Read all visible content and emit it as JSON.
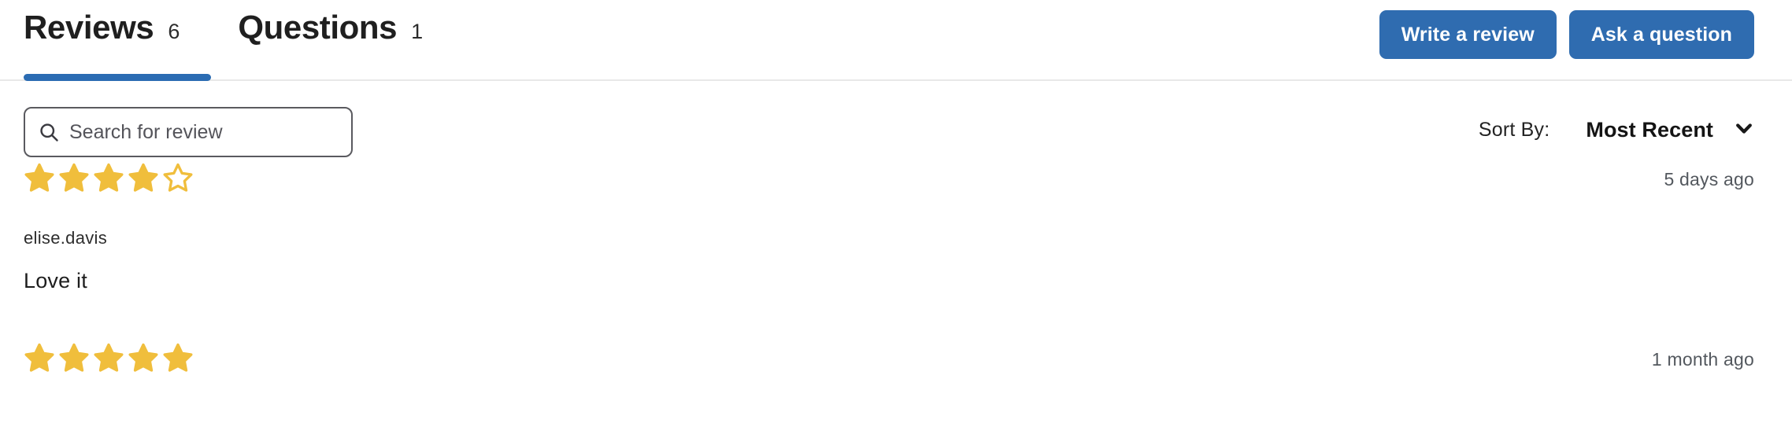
{
  "tabs": [
    {
      "label": "Reviews",
      "count": "6",
      "active": true,
      "icon": ""
    },
    {
      "label": "Questions",
      "count": "1",
      "active": false,
      "icon": ""
    }
  ],
  "header": {
    "write_review_label": "Write a review",
    "ask_question_label": "Ask a question",
    "button_color": "#2f6cb0",
    "active_tab_underline_color": "#2b6cb3"
  },
  "search": {
    "icon": "search-icon",
    "placeholder": "Search for review",
    "value": ""
  },
  "sort": {
    "label": "Sort By:",
    "value": "Most Recent",
    "icon": "chevron-down-icon"
  },
  "stars": {
    "filled_color": "#f0be3c",
    "empty_color": "#f0be3c",
    "max": 5
  },
  "reviews": [
    {
      "rating": 4,
      "time": "5 days ago",
      "author": "elise.davis",
      "body": "Love it"
    },
    {
      "rating": 5,
      "time": "1 month ago",
      "author": "",
      "body": ""
    }
  ]
}
